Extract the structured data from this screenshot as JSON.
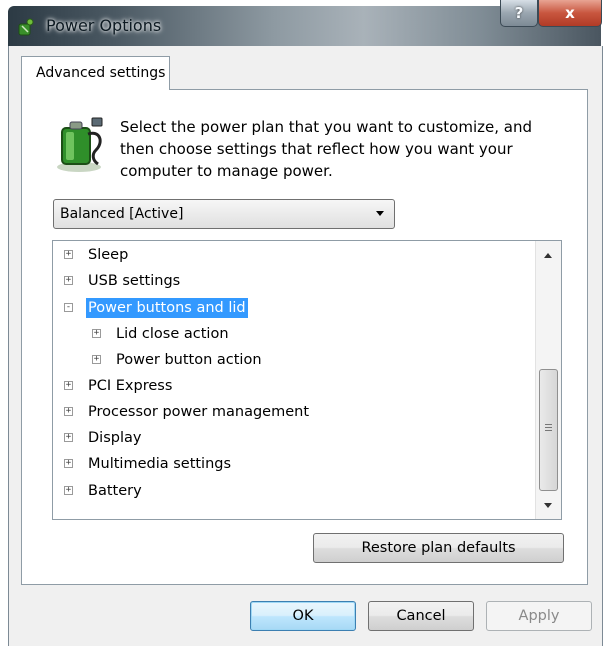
{
  "window": {
    "title": "Power Options",
    "help_glyph": "?",
    "close_glyph": "x",
    "icon": "power-options-icon"
  },
  "tab": {
    "label": "Advanced settings"
  },
  "description": "Select the power plan that you want to customize, and then choose settings that reflect how you want your computer to manage power.",
  "plan_select": {
    "value": "Balanced [Active]"
  },
  "tree": {
    "items": [
      {
        "label": "Sleep",
        "expander": "+",
        "level": 0
      },
      {
        "label": "USB settings",
        "expander": "+",
        "level": 0
      },
      {
        "label": "Power buttons and lid",
        "expander": "-",
        "level": 0,
        "selected": true
      },
      {
        "label": "Lid close action",
        "expander": "+",
        "level": 1
      },
      {
        "label": "Power button action",
        "expander": "+",
        "level": 1
      },
      {
        "label": "PCI Express",
        "expander": "+",
        "level": 0
      },
      {
        "label": "Processor power management",
        "expander": "+",
        "level": 0
      },
      {
        "label": "Display",
        "expander": "+",
        "level": 0
      },
      {
        "label": "Multimedia settings",
        "expander": "+",
        "level": 0
      },
      {
        "label": "Battery",
        "expander": "+",
        "level": 0
      }
    ]
  },
  "buttons": {
    "restore": "Restore plan defaults",
    "ok": "OK",
    "cancel": "Cancel",
    "apply": "Apply"
  },
  "colors": {
    "selection": "#3399ff",
    "window_bg": "#f0f0f0",
    "close_button": "#c8563f"
  }
}
